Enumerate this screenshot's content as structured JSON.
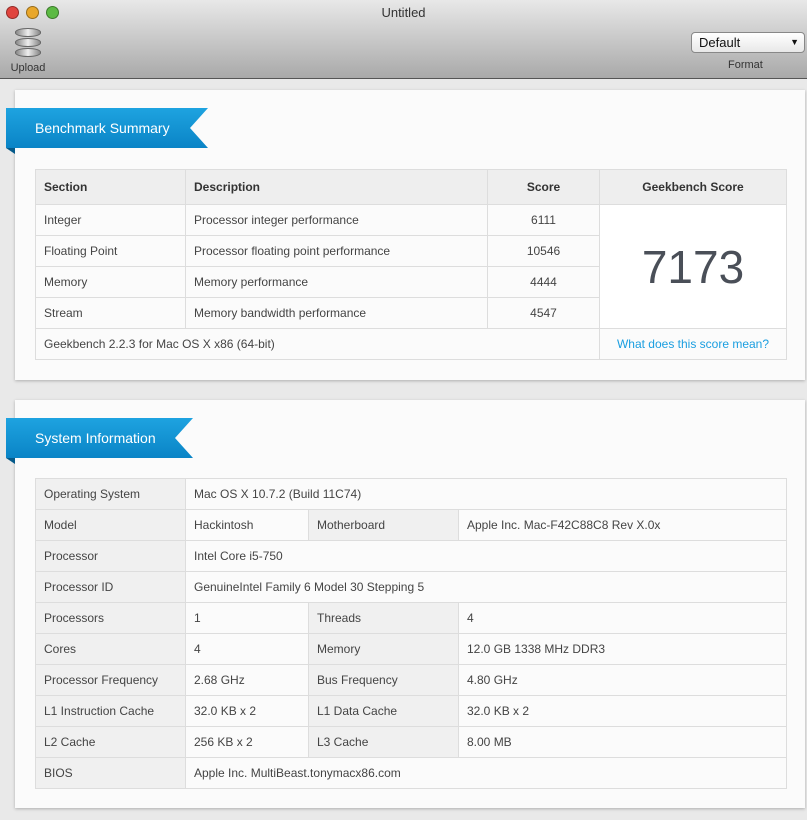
{
  "window": {
    "title": "Untitled"
  },
  "toolbar": {
    "upload_label": "Upload",
    "format_value": "Default",
    "format_label": "Format"
  },
  "benchmark": {
    "title": "Benchmark Summary",
    "headers": [
      "Section",
      "Description",
      "Score",
      "Geekbench Score"
    ],
    "rows": [
      {
        "section": "Integer",
        "description": "Processor integer performance",
        "score": "6111"
      },
      {
        "section": "Floating Point",
        "description": "Processor floating point performance",
        "score": "10546"
      },
      {
        "section": "Memory",
        "description": "Memory performance",
        "score": "4444"
      },
      {
        "section": "Stream",
        "description": "Memory bandwidth performance",
        "score": "4547"
      }
    ],
    "geekbench_score": "7173",
    "version": "Geekbench 2.2.3 for Mac OS X x86 (64-bit)",
    "help_link": "What does this score mean?"
  },
  "system": {
    "title": "System Information",
    "os_label": "Operating System",
    "os": "Mac OS X 10.7.2 (Build 11C74)",
    "model_label": "Model",
    "model": "Hackintosh",
    "motherboard_label": "Motherboard",
    "motherboard": "Apple Inc. Mac-F42C88C8 Rev X.0x",
    "processor_label": "Processor",
    "processor": "Intel Core i5-750",
    "processor_id_label": "Processor ID",
    "processor_id": "GenuineIntel Family 6 Model 30 Stepping 5",
    "processors_label": "Processors",
    "processors": "1",
    "threads_label": "Threads",
    "threads": "4",
    "cores_label": "Cores",
    "cores": "4",
    "memory_label": "Memory",
    "memory": "12.0 GB 1338 MHz DDR3",
    "freq_label": "Processor Frequency",
    "freq": "2.68 GHz",
    "bus_label": "Bus Frequency",
    "bus": "4.80 GHz",
    "l1i_label": "L1 Instruction Cache",
    "l1i": "32.0 KB x 2",
    "l1d_label": "L1 Data Cache",
    "l1d": "32.0 KB x 2",
    "l2_label": "L2 Cache",
    "l2": "256 KB x 2",
    "l3_label": "L3 Cache",
    "l3": "8.00 MB",
    "bios_label": "BIOS",
    "bios": "Apple Inc. MultiBeast.tonymacx86.com"
  }
}
